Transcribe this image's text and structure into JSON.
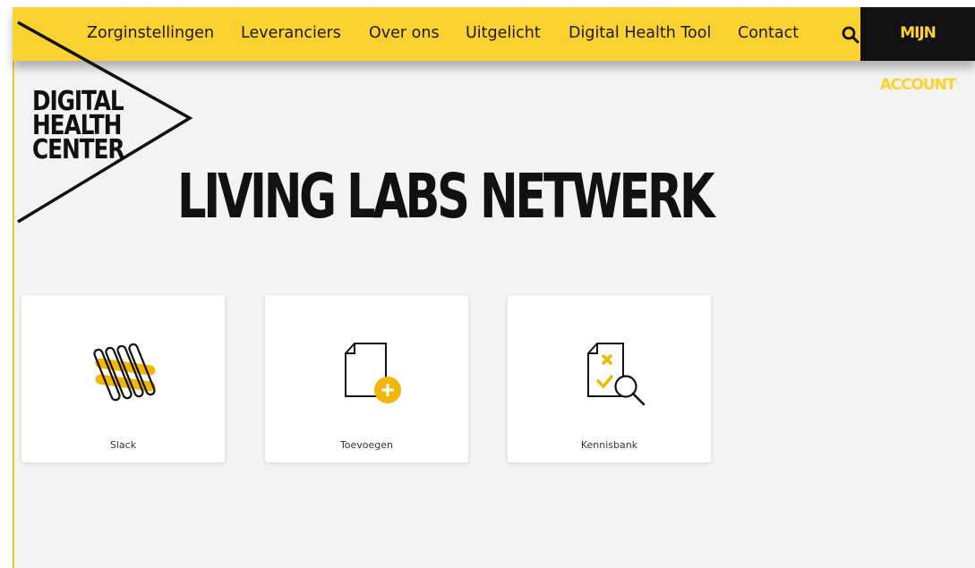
{
  "nav": {
    "items": [
      {
        "label": "Zorginstellingen"
      },
      {
        "label": "Leveranciers"
      },
      {
        "label": "Over ons"
      },
      {
        "label": "Uitgelicht"
      },
      {
        "label": "Digital Health Tool"
      },
      {
        "label": "Contact"
      }
    ],
    "search_icon": "search-icon",
    "account_label": "MIJN ACCOUNT"
  },
  "logo": {
    "lines": [
      "DIGITAL",
      "HEALTH",
      "CENTER"
    ]
  },
  "page": {
    "title": "LIVING LABS NETWERK"
  },
  "cards": [
    {
      "label": "Slack",
      "icon": "slack-icon"
    },
    {
      "label": "Toevoegen",
      "icon": "add-document-icon"
    },
    {
      "label": "Kennisbank",
      "icon": "document-search-icon"
    }
  ],
  "colors": {
    "accent": "#fcd230",
    "dark": "#111111",
    "background": "#f4f3f4"
  }
}
